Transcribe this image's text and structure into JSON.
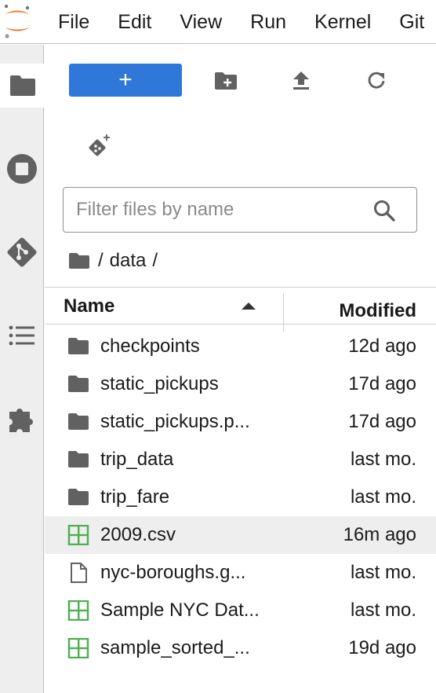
{
  "menubar": {
    "items": [
      "File",
      "Edit",
      "View",
      "Run",
      "Kernel",
      "Git"
    ]
  },
  "sidebar": {
    "icons": [
      "folder-icon",
      "stop-circle-icon",
      "git-icon",
      "list-icon",
      "puzzle-icon"
    ]
  },
  "toolbar": {
    "new_label": "+"
  },
  "filter": {
    "placeholder": "Filter files by name",
    "value": ""
  },
  "breadcrumb": {
    "root": "/",
    "folder": "data",
    "trailing": "/"
  },
  "table": {
    "name_header": "Name",
    "modified_header": "Modified",
    "rows": [
      {
        "name": "checkpoints",
        "modified": "12d ago",
        "type": "folder"
      },
      {
        "name": "static_pickups",
        "modified": "17d ago",
        "type": "folder"
      },
      {
        "name": "static_pickups.p...",
        "modified": "17d ago",
        "type": "folder"
      },
      {
        "name": "trip_data",
        "modified": "last mo.",
        "type": "folder"
      },
      {
        "name": "trip_fare",
        "modified": "last mo.",
        "type": "folder"
      },
      {
        "name": "2009.csv",
        "modified": "16m ago",
        "type": "csv"
      },
      {
        "name": "nyc-boroughs.g...",
        "modified": "last mo.",
        "type": "file"
      },
      {
        "name": "Sample NYC Dat...",
        "modified": "last mo.",
        "type": "csv"
      },
      {
        "name": "sample_sorted_...",
        "modified": "19d ago",
        "type": "csv"
      }
    ]
  },
  "colors": {
    "accent": "#2f77d9",
    "csv_green": "#4caf50",
    "logo_orange": "#f37726"
  }
}
